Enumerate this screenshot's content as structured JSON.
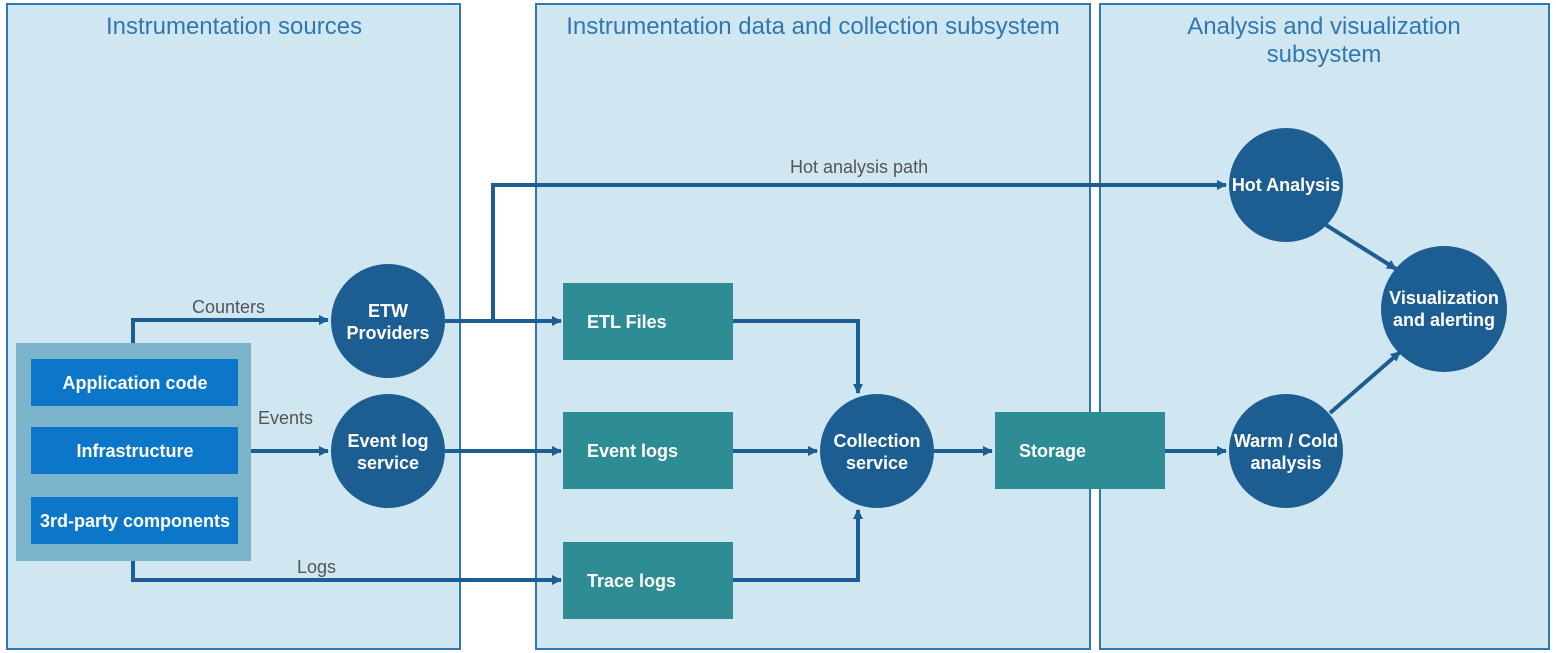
{
  "panels": {
    "sources": "Instrumentation sources",
    "collection": "Instrumentation data and collection subsystem",
    "analysis": "Analysis and visualization\nsubsystem"
  },
  "sources": {
    "app": "Application code",
    "infra": "Infrastructure",
    "thirdparty": "3rd-party components"
  },
  "circles": {
    "etw": "ETW\nProviders",
    "eventlog": "Event log\nservice",
    "collection": "Collection\nservice",
    "hot": "Hot Analysis",
    "warmcold": "Warm / Cold\nanalysis",
    "viz": "Visualization\nand alerting"
  },
  "rects": {
    "etl": "ETL Files",
    "eventlogs": "Event logs",
    "tracelogs": "Trace logs",
    "storage": "Storage"
  },
  "edges": {
    "counters": "Counters",
    "events": "Events",
    "logs": "Logs",
    "hotpath": "Hot analysis path"
  },
  "colors": {
    "panelFill": "#d0e6f0",
    "panelStroke": "#3078b0",
    "sourceGroup": "#7bb4cb",
    "sourceBox": "#0c76c8",
    "circle": "#1c5e92",
    "tealRect": "#2e8d94",
    "arrow": "#1c5e92"
  }
}
